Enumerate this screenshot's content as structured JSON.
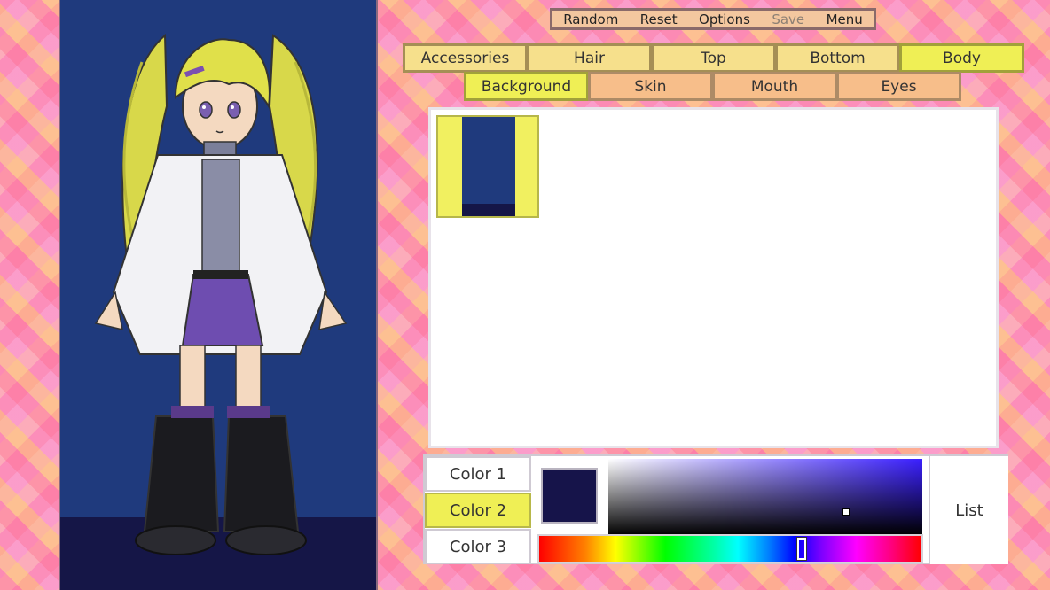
{
  "top_menu": {
    "random": "Random",
    "reset": "Reset",
    "options": "Options",
    "save": "Save",
    "menu": "Menu"
  },
  "tabs_row1": [
    "Accessories",
    "Hair",
    "Top",
    "Bottom",
    "Body"
  ],
  "tabs_row2": [
    "Background",
    "Skin",
    "Mouth",
    "Eyes"
  ],
  "active_tabs": [
    "Body",
    "Background"
  ],
  "color_buttons": [
    "Color 1",
    "Color 2",
    "Color 3"
  ],
  "active_color": "Color 2",
  "list_label": "List",
  "colors": {
    "preview_background": "#1f3a7d",
    "preview_floor": "#151647",
    "current_color": "#16144a",
    "active_yellow": "#efef55"
  }
}
